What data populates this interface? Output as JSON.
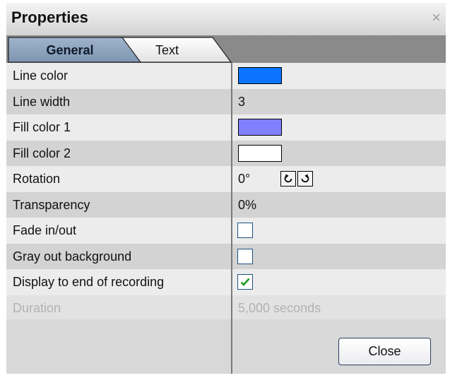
{
  "window": {
    "title": "Properties",
    "close_glyph": "×"
  },
  "tabs": [
    {
      "label": "General",
      "active": true
    },
    {
      "label": "Text",
      "active": false
    }
  ],
  "properties": {
    "line_color": {
      "label": "Line color",
      "color": "#0a74ff"
    },
    "line_width": {
      "label": "Line width",
      "value": "3"
    },
    "fill_color_1": {
      "label": "Fill color 1",
      "color": "#8080ff"
    },
    "fill_color_2": {
      "label": "Fill color 2",
      "color": "#ffffff"
    },
    "rotation": {
      "label": "Rotation",
      "value": "0°",
      "icons": [
        "rotate-left-icon",
        "rotate-right-icon"
      ]
    },
    "transparency": {
      "label": "Transparency",
      "value": "0%"
    },
    "fade_in_out": {
      "label": "Fade in/out",
      "checked": false
    },
    "gray_out_background": {
      "label": "Gray out background",
      "checked": false
    },
    "display_to_end": {
      "label": "Display to end of recording",
      "checked": true
    },
    "duration": {
      "label": "Duration",
      "value": "5,000 seconds",
      "disabled": true
    }
  },
  "footer": {
    "close_label": "Close"
  },
  "colors": {
    "checkmark": "#1e9a1e",
    "tab_active_top": "#9fb3cc",
    "tab_active_bottom": "#7e95b1"
  }
}
